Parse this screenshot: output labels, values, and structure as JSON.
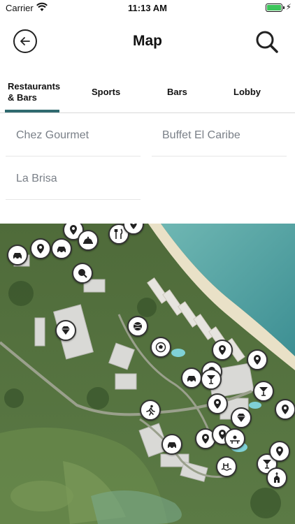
{
  "status_bar": {
    "carrier": "Carrier",
    "time": "11:13 AM"
  },
  "header": {
    "title": "Map",
    "back_icon": "back-arrow-icon",
    "search_icon": "search-icon"
  },
  "tabs": [
    {
      "label": "Restaurants\n& Bars",
      "active": true
    },
    {
      "label": "Sports",
      "active": false
    },
    {
      "label": "Bars",
      "active": false
    },
    {
      "label": "Lobby",
      "active": false
    }
  ],
  "places": [
    {
      "label": "Chez Gourmet"
    },
    {
      "label": "Buffet El Caribe"
    },
    {
      "label": "La Brisa"
    }
  ],
  "colors": {
    "accent": "#2f6a6f",
    "water": "#4fa3a1",
    "beach": "#e9e1c7",
    "vegetation": "#4f6b3a"
  },
  "map_pins": [
    {
      "icon": "location-pin-icon"
    },
    {
      "icon": "location-pin-icon"
    },
    {
      "icon": "car-icon"
    },
    {
      "icon": "car-icon"
    },
    {
      "icon": "food-cloche-icon"
    },
    {
      "icon": "cutlery-icon"
    },
    {
      "icon": "location-pin-icon"
    },
    {
      "icon": "ping-pong-icon"
    },
    {
      "icon": "diamond-icon"
    },
    {
      "icon": "tennis-icon"
    },
    {
      "icon": "soccer-ball-icon"
    },
    {
      "icon": "location-pin-icon"
    },
    {
      "icon": "location-pin-icon"
    },
    {
      "icon": "location-pin-icon"
    },
    {
      "icon": "car-icon"
    },
    {
      "icon": "cocktail-icon"
    },
    {
      "icon": "cocktail-icon"
    },
    {
      "icon": "location-pin-icon"
    },
    {
      "icon": "running-icon"
    },
    {
      "icon": "diamond-icon"
    },
    {
      "icon": "location-pin-icon"
    },
    {
      "icon": "car-icon"
    },
    {
      "icon": "location-pin-icon"
    },
    {
      "icon": "location-pin-icon"
    },
    {
      "icon": "playground-icon"
    },
    {
      "icon": "swimming-icon"
    },
    {
      "icon": "cocktail-icon"
    },
    {
      "icon": "location-pin-icon"
    },
    {
      "icon": "chapel-icon"
    }
  ]
}
